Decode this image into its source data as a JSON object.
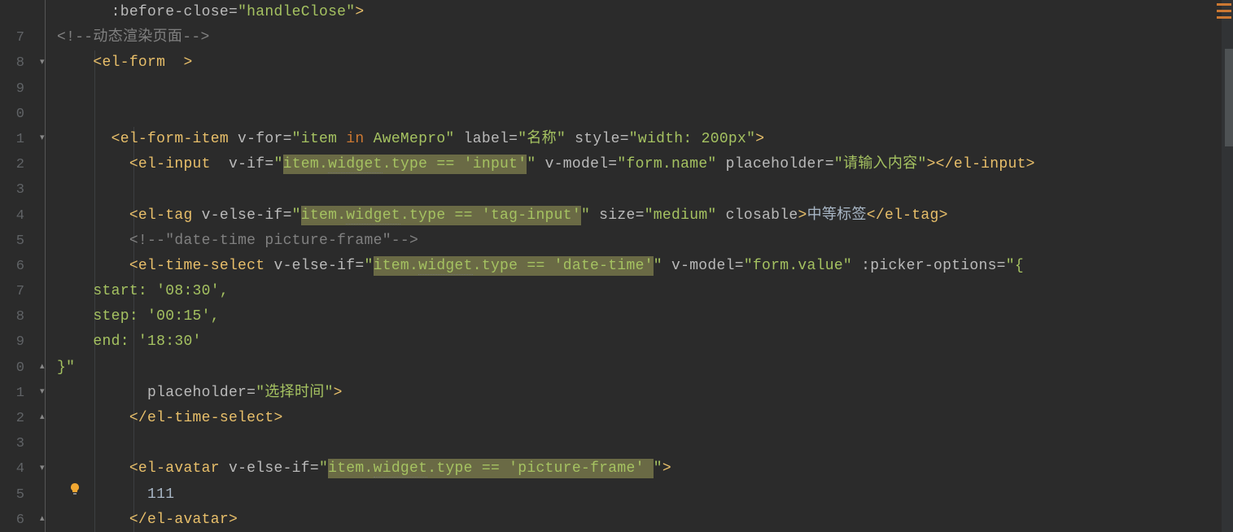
{
  "gutter": {
    "lines": [
      "",
      "7",
      "8",
      "9",
      "0",
      "1",
      "2",
      "3",
      "4",
      "5",
      "6",
      "7",
      "8",
      "9",
      "0",
      "1",
      "2",
      "3",
      "4",
      "5",
      "6"
    ]
  },
  "code": {
    "l0_before": ":before-close=",
    "l0_val": "\"handleClose\"",
    "l0_close": ">",
    "l1_open": "<!--",
    "l1_text": "动态渲染页面",
    "l1_close": "-->",
    "l2_tag": "<el-form  >",
    "l5_tag_open": "<el-form-item",
    "l5_attr1": " v-for=",
    "l5_val1a": "\"item ",
    "l5_val1_in": "in",
    "l5_val1b": " AweMepro\"",
    "l5_attr2": " label=",
    "l5_val2": "\"名称\"",
    "l5_attr3": " style=",
    "l5_val3": "\"width: 200px\"",
    "l5_close": ">",
    "l6_tag_open": "<el-input ",
    "l6_attr1": " v-if=",
    "l6_hl": "item.widget.type == 'input'",
    "l6_attr2": " v-model=",
    "l6_val2": "\"form.name\"",
    "l6_attr3": " placeholder=",
    "l6_val3": "\"请输入内容\"",
    "l6_close": "></el-input>",
    "l8_tag_open": "<el-tag",
    "l8_attr1": " v-else-if=",
    "l8_hl": "item.widget.type == 'tag-input'",
    "l8_attr2": " size=",
    "l8_val2": "\"medium\"",
    "l8_attr3": " closable",
    "l8_text": "中等标签",
    "l8_close1": ">",
    "l8_close2": "</el-tag>",
    "l9_open": "<!--",
    "l9_text": "\"date-time picture-frame\"",
    "l9_close": "-->",
    "l10_tag_open": "<el-time-select",
    "l10_attr1": " v-else-if=",
    "l10_hl": "item.widget.type == 'date-time'",
    "l10_attr2": " v-model=",
    "l10_val2": "\"form.value\"",
    "l10_attr3": " :picker-options=",
    "l10_val3": "\"{",
    "l11": "  start: '08:30',",
    "l12": "  step: '00:15',",
    "l13": "  end: '18:30'",
    "l14": "}\"",
    "l15_attr": "placeholder=",
    "l15_val": "\"选择时间\"",
    "l15_close": ">",
    "l16": "</el-time-select>",
    "l18_tag_open": "<el-avatar",
    "l18_attr1": " v-else-if=",
    "l18_hl": "item.widget.type == 'picture-frame' ",
    "l18_close": ">",
    "l19": "111",
    "l20": "</el-avatar>"
  }
}
